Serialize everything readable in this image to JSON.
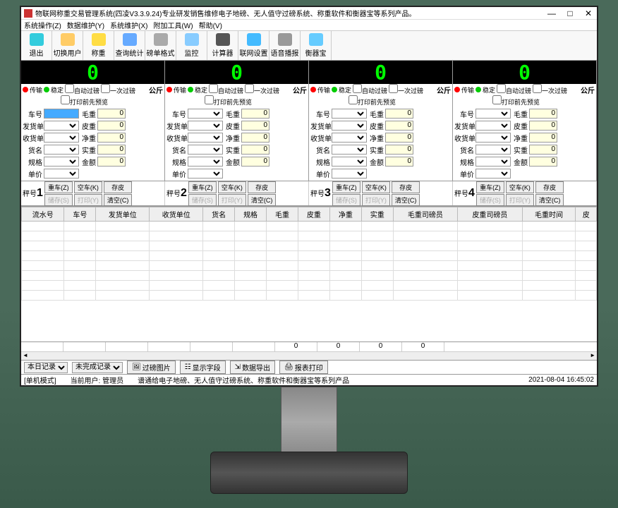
{
  "title": "物联网称重交易管理系统(四凌V3.3.9.24)专业研发销售维修电子地磅、无人值守过磅系统、称重软件和衡器宝等系列产品。",
  "menu": [
    "系统操作(Z)",
    "数据维护(Y)",
    "系统维护(X)",
    "附加工具(W)",
    "帮助(V)"
  ],
  "toolbar": [
    {
      "label": "退出",
      "icon": "exit"
    },
    {
      "label": "切换用户",
      "icon": "user"
    },
    {
      "label": "称重",
      "icon": "scale"
    },
    {
      "label": "查询统计",
      "icon": "stats"
    },
    {
      "label": "磅单格式",
      "icon": "form"
    },
    {
      "label": "监控",
      "icon": "monitor"
    },
    {
      "label": "计算器",
      "icon": "calc"
    },
    {
      "label": "联网设置",
      "icon": "net"
    },
    {
      "label": "语音播报",
      "icon": "voice"
    },
    {
      "label": "衡器宝",
      "icon": "device"
    }
  ],
  "scale_labels": {
    "transmit": "传输",
    "stable": "稳定",
    "auto": "自动过磅",
    "once": "一次过磅",
    "preview": "打印前先预览",
    "unit": "公斤",
    "car": "车号",
    "sender": "发货单位",
    "receiver": "收货单位",
    "goods": "货名",
    "spec": "规格",
    "price": "单价",
    "gross": "毛重",
    "tare": "皮重",
    "net": "净重",
    "actual": "实重",
    "amount": "金额"
  },
  "scales": [
    {
      "display": "0",
      "gross": "0",
      "tare": "0",
      "net": "0",
      "actual": "0",
      "amount": "0"
    },
    {
      "display": "0",
      "gross": "0",
      "tare": "0",
      "net": "0",
      "actual": "0",
      "amount": "0"
    },
    {
      "display": "0",
      "gross": "0",
      "tare": "0",
      "net": "0",
      "actual": "0",
      "amount": "0"
    },
    {
      "display": "0",
      "gross": "0",
      "tare": "0",
      "net": "0",
      "actual": "0",
      "amount": "0"
    }
  ],
  "action_prefix": "秤号",
  "actions": {
    "heavy": "重车(Z)",
    "empty": "空车(K)",
    "savetare": "存皮",
    "save": "储存(S)",
    "print": "打印(Y)",
    "clear": "清空(C)"
  },
  "grid_cols": [
    "流水号",
    "车号",
    "发货单位",
    "收货单位",
    "货名",
    "规格",
    "毛重",
    "皮重",
    "净重",
    "实重",
    "毛重司磅员",
    "皮重司磅员",
    "毛重时间",
    "皮"
  ],
  "totals": [
    "0",
    "0",
    "0",
    "0"
  ],
  "filter": {
    "scope": "本日记录",
    "status": "未完成记录",
    "btn_img": "过磅图片",
    "btn_cols": "显示字段",
    "btn_export": "数据导出",
    "btn_print": "报表打印"
  },
  "status": {
    "mode": "[单机模式]",
    "user_label": "当前用户: 管理员",
    "marquee": "谱通给电子地磅、无人值守过磅系统、称重软件和衡器宝等系列产品",
    "time": "2021-08-04 16:45:02"
  }
}
